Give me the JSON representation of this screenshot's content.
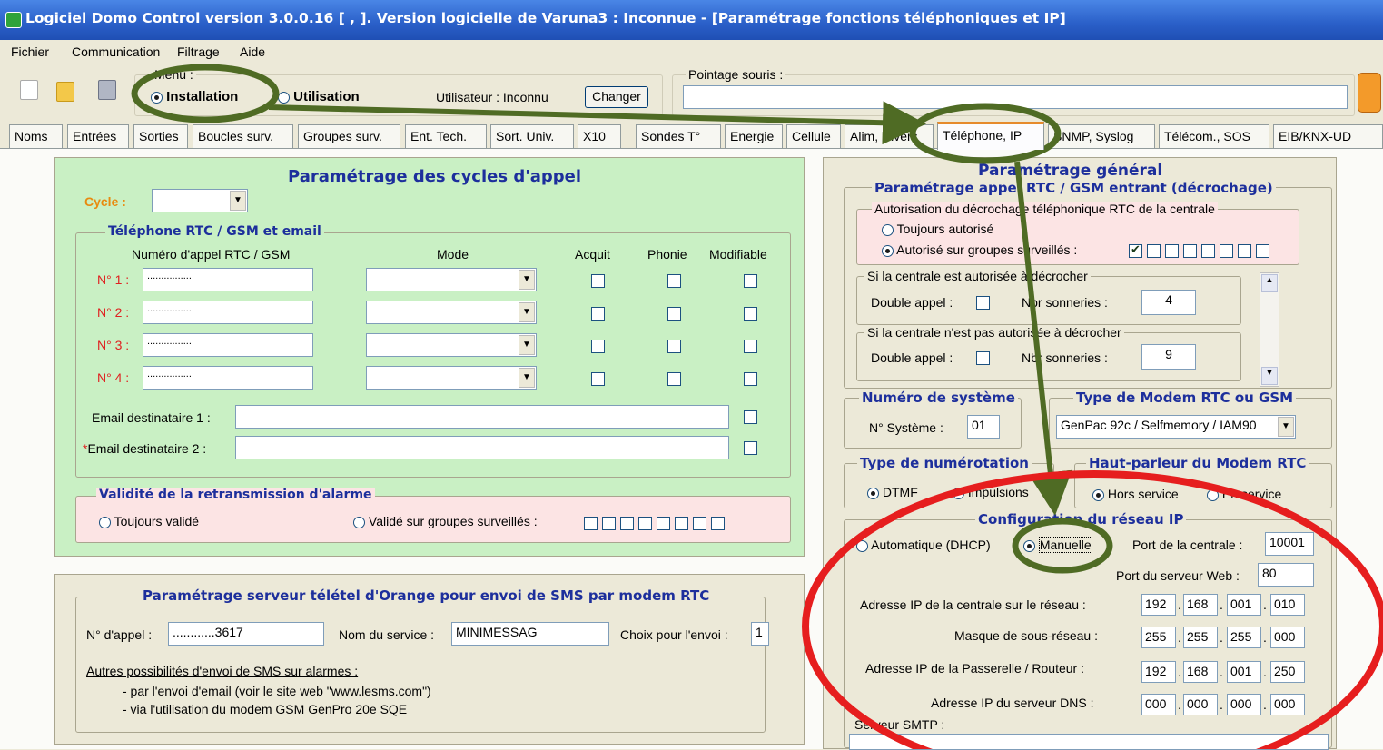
{
  "window": {
    "title": "Logiciel Domo Control version 3.0.0.16 [ , ].  Version logicielle de Varuna3 : Inconnue - [Paramétrage fonctions téléphoniques et IP]"
  },
  "menu": [
    "Fichier",
    "Communication",
    "Filtrage",
    "Aide"
  ],
  "toolbar": {
    "menu_label": "Menu :",
    "installation": "Installation",
    "utilisation": "Utilisation",
    "utilisateur": "Utilisateur : Inconnu",
    "changer": "Changer",
    "pointage": "Pointage souris :",
    "pointage_value": ""
  },
  "tabs": [
    "Noms",
    "Entrées",
    "Sorties",
    "Boucles surv.",
    "Groupes surv.",
    "Ent. Tech.",
    "Sort. Univ.",
    "X10",
    "Sondes T°",
    "Energie",
    "Cellule",
    "Alim, Divers",
    "Téléphone, IP",
    "SNMP, Syslog",
    "Télécom., SOS",
    "EIB/KNX-UD"
  ],
  "active_tab": "Téléphone, IP",
  "cycles": {
    "title": "Paramétrage des cycles d'appel",
    "cycle_label": "Cycle :",
    "cycle_value": "",
    "phone_group": "Téléphone RTC / GSM et email",
    "col_numero": "Numéro d'appel RTC / GSM",
    "col_mode": "Mode",
    "col_acquit": "Acquit",
    "col_phonie": "Phonie",
    "col_modifiable": "Modifiable",
    "rows": [
      {
        "label": "N° 1 :",
        "value": "................"
      },
      {
        "label": "N° 2 :",
        "value": "................"
      },
      {
        "label": "N° 3 :",
        "value": "................"
      },
      {
        "label": "N° 4 :",
        "value": "................"
      }
    ],
    "email1_label": "Email destinataire 1 :",
    "email2_marker": "*",
    "email2_label": "Email destinataire 2 :",
    "validity_group": "Validité de la retransmission d'alarme",
    "toujours_valide": "Toujours validé",
    "valide_groupes": "Validé sur groupes surveillés :"
  },
  "sms": {
    "title": "Paramétrage serveur télétel d'Orange pour envoi de SMS par modem RTC",
    "nappel_label": "N° d'appel :",
    "nappel_value": "............3617",
    "service_label": "Nom du service :",
    "service_value": "MINIMESSAG",
    "choix_label": "Choix pour l'envoi :",
    "choix_value": "1",
    "autres": "Autres possibilités d'envoi de SMS sur alarmes :",
    "line1": "- par l'envoi d'email  (voir le site web \"www.lesms.com\")",
    "line2": "- via l'utilisation du modem GSM GenPro 20e SQE"
  },
  "general": {
    "title": "Paramétrage général",
    "appel_group": "Paramétrage appel RTC / GSM entrant (décrochage)",
    "auth_group": "Autorisation du décrochage téléphonique RTC de la centrale",
    "toujours_autorise": "Toujours autorisé",
    "autorise_groupes": "Autorisé sur groupes surveillés :",
    "si_autorisee": "Si la centrale est autorisée à décrocher",
    "si_non_autorisee": "Si la centrale n'est pas autorisée à décrocher",
    "double_appel": "Double appel :",
    "nbr_sonneries": "Nbr sonneries :",
    "nbr1": "4",
    "nbr2": "9",
    "num_systeme_group": "Numéro de système",
    "nsysteme_label": "N° Système :",
    "nsysteme_value": "01",
    "modem_group": "Type de Modem RTC ou GSM",
    "modem_value": "GenPac 92c / Selfmemory / IAM90",
    "numerotation_group": "Type de numérotation",
    "dtmf": "DTMF",
    "impulsions": "Impulsions",
    "hp_group": "Haut-parleur du Modem RTC",
    "hors_service": "Hors service",
    "en_service": "En service",
    "ip_group": "Configuration du réseau IP",
    "automatique": "Automatique (DHCP)",
    "manuelle": "Manuelle",
    "port_centrale_label": "Port de la centrale :",
    "port_centrale": "10001",
    "port_web_label": "Port du serveur Web :",
    "port_web": "80",
    "ip_rows": [
      {
        "label": "Adresse IP de la centrale sur le réseau :",
        "values": [
          "192",
          "168",
          "001",
          "010"
        ]
      },
      {
        "label": "Masque de sous-réseau :",
        "values": [
          "255",
          "255",
          "255",
          "000"
        ]
      },
      {
        "label": "Adresse IP de la Passerelle / Routeur :",
        "values": [
          "192",
          "168",
          "001",
          "250"
        ]
      },
      {
        "label": "Adresse IP du serveur DNS :",
        "values": [
          "000",
          "000",
          "000",
          "000"
        ]
      }
    ],
    "smtp_label": "Serveur SMTP :"
  },
  "colors": {
    "title_bar": "#2a5fc8",
    "left_panel": "#c9f0c4",
    "pink_group": "#fce4e4",
    "annotation_green": "#4f6b24",
    "annotation_red": "#e61e1e"
  }
}
